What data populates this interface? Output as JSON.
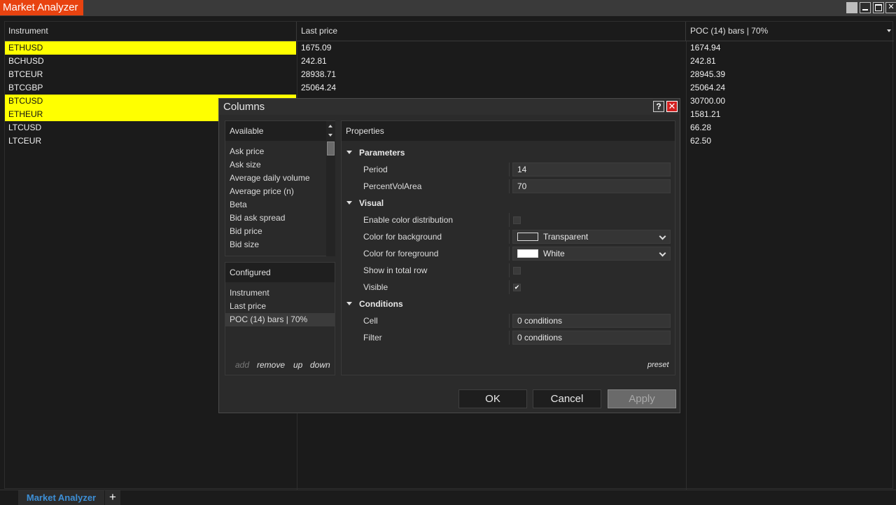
{
  "window": {
    "title": "Market Analyzer"
  },
  "grid": {
    "columns": [
      "Instrument",
      "Last price",
      "POC (14) bars | 70%"
    ],
    "rows": [
      {
        "instrument": "ETHUSD",
        "last": "1675.09",
        "poc": "1674.94",
        "highlight": true
      },
      {
        "instrument": "BCHUSD",
        "last": "242.81",
        "poc": "242.81",
        "highlight": false
      },
      {
        "instrument": "BTCEUR",
        "last": "28938.71",
        "poc": "28945.39",
        "highlight": false
      },
      {
        "instrument": "BTCGBP",
        "last": "25064.24",
        "poc": "25064.24",
        "highlight": false
      },
      {
        "instrument": "BTCUSD",
        "last": "",
        "poc": "30700.00",
        "highlight": true
      },
      {
        "instrument": "ETHEUR",
        "last": "",
        "poc": "1581.21",
        "highlight": true
      },
      {
        "instrument": "LTCUSD",
        "last": "",
        "poc": "66.28",
        "highlight": false
      },
      {
        "instrument": "LTCEUR",
        "last": "",
        "poc": "62.50",
        "highlight": false
      }
    ],
    "highlight_color": "#ffff00"
  },
  "dialog": {
    "title": "Columns",
    "help_label": "?",
    "available": {
      "header": "Available",
      "items": [
        "Ask price",
        "Ask size",
        "Average daily volume",
        "Average price (n)",
        "Beta",
        "Bid ask spread",
        "Bid price",
        "Bid size"
      ]
    },
    "configured": {
      "header": "Configured",
      "items": [
        "Instrument",
        "Last price",
        "POC (14) bars | 70%"
      ],
      "selected_index": 2,
      "actions": {
        "add": "add",
        "remove": "remove",
        "up": "up",
        "down": "down"
      }
    },
    "properties": {
      "header": "Properties",
      "parameters": {
        "label": "Parameters",
        "period_label": "Period",
        "period_value": "14",
        "percent_label": "PercentVolArea",
        "percent_value": "70"
      },
      "visual": {
        "label": "Visual",
        "color_dist_label": "Enable color distribution",
        "color_dist_checked": false,
        "bg_label": "Color for background",
        "bg_value": "Transparent",
        "fg_label": "Color for foreground",
        "fg_value": "White",
        "total_row_label": "Show in total row",
        "total_row_checked": false,
        "visible_label": "Visible",
        "visible_checked": true,
        "check_mark": "✔"
      },
      "conditions": {
        "label": "Conditions",
        "cell_label": "Cell",
        "cell_value": "0 conditions",
        "filter_label": "Filter",
        "filter_value": "0 conditions"
      },
      "preset": "preset"
    },
    "buttons": {
      "ok": "OK",
      "cancel": "Cancel",
      "apply": "Apply"
    }
  },
  "tabs": {
    "active": "Market Analyzer",
    "add": "+"
  },
  "colors": {
    "accent": "#e84310",
    "tab_text": "#3d8fd6",
    "close": "#d32020"
  }
}
